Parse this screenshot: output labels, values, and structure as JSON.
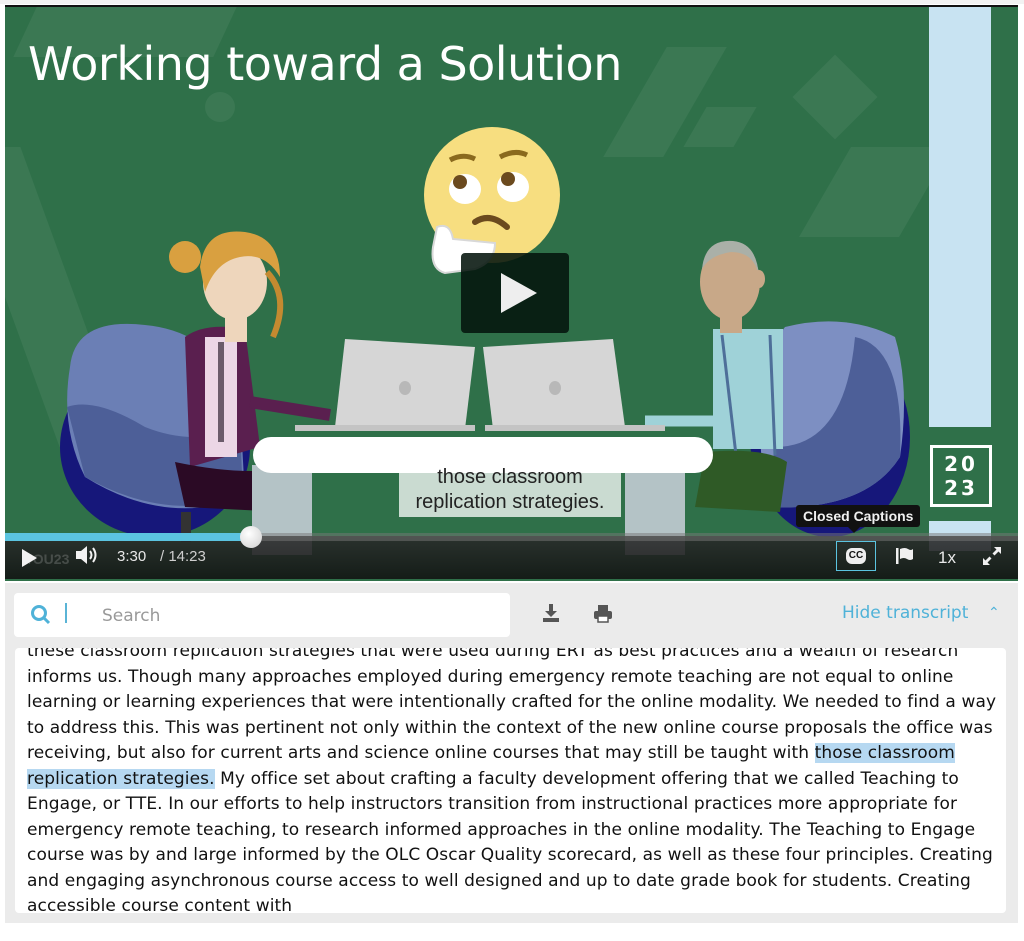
{
  "video": {
    "title": "Working toward a Solution",
    "year_logo_line1": "20",
    "year_logo_line2": "23",
    "caption_line1": "those classroom",
    "caption_line2": "replication strategies.",
    "watermark": "#OU23",
    "progress": 0.2433,
    "time_current": "3:30",
    "time_total": "/ 14:23",
    "tooltip": "Closed Captions",
    "cc_label": "CC",
    "speed": "1x",
    "accent_color": "#5bc4e0",
    "background_color": "#2f7049"
  },
  "transcript": {
    "search_placeholder": "Search",
    "search_value": "",
    "hide_label": "Hide transcript",
    "chevron": "^",
    "accent_color": "#4fb2d8",
    "highlight_color": "#b6d8f1",
    "text_before": "these classroom replication strategies that were used during ERT as best practices and a wealth of research informs us. Though many approaches employed during emergency remote teaching are not equal to online learning or learning experiences that were intentionally crafted for the online modality. We needed to find a way to address this. This was pertinent not only within the context of the new online course proposals the office was receiving, but also for current arts and science online courses that may still be taught with ",
    "text_highlight": "those classroom replication strategies.",
    "text_after": " My office set about crafting a faculty development offering that we called Teaching to Engage, or TTE. In our efforts to help instructors transition from instructional practices more appropriate for emergency remote teaching, to research informed approaches in the online modality. The Teaching to Engage course was by and large informed by the OLC Oscar Quality scorecard, as well as these four principles. Creating and engaging asynchronous course access to well designed and up to date grade book for students. Creating accessible course content with"
  }
}
